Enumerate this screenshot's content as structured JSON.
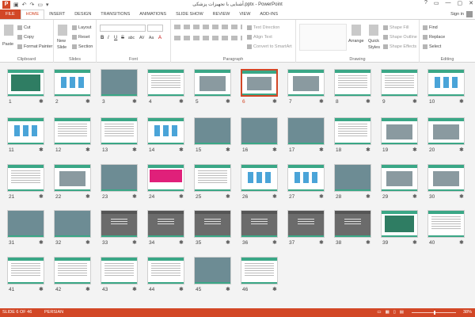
{
  "window": {
    "app_icon": "P",
    "title": "آشنایی با تجهیزات پزشکی.pptx - PowerPoint",
    "controls": [
      "?",
      "▭",
      "—",
      "▢",
      "✕"
    ]
  },
  "qat": {
    "save_icon": "▣",
    "undo_icon": "↶",
    "redo_icon": "↷",
    "start_icon": "▭",
    "more_icon": "▾"
  },
  "tabs": [
    "FILE",
    "HOME",
    "INSERT",
    "DESIGN",
    "TRANSITIONS",
    "ANIMATIONS",
    "SLIDE SHOW",
    "REVIEW",
    "VIEW",
    "ADD-INS"
  ],
  "active_tab": "HOME",
  "sign_in": "Sign in",
  "ribbon": {
    "clipboard": {
      "label": "Clipboard",
      "paste": "Paste",
      "cut": "Cut",
      "copy": "Copy",
      "format_painter": "Format Painter"
    },
    "slides": {
      "label": "Slides",
      "new_slide": "New",
      "new_slide_2": "Slide",
      "layout": "Layout",
      "reset": "Reset",
      "section": "Section"
    },
    "font": {
      "label": "Font",
      "bold": "B",
      "italic": "I",
      "underline": "U",
      "strike": "S",
      "shadow": "abc",
      "spacing": "AV",
      "case": "Aa",
      "color": "A"
    },
    "paragraph": {
      "label": "Paragraph",
      "text_direction": "Text Direction",
      "align_text": "Align Text",
      "convert_smartart": "Convert to SmartArt"
    },
    "drawing": {
      "label": "Drawing",
      "arrange": "Arrange",
      "quick_styles": "Quick",
      "quick_styles_2": "Styles",
      "shape_fill": "Shape Fill",
      "shape_outline": "Shape Outline",
      "shape_effects": "Shape Effects"
    },
    "editing": {
      "label": "Editing",
      "find": "Find",
      "replace": "Replace",
      "select": "Select"
    }
  },
  "slides": [
    {
      "n": "1",
      "style": "title"
    },
    {
      "n": "2",
      "style": "icons"
    },
    {
      "n": "3",
      "style": "photo"
    },
    {
      "n": "4",
      "style": "text"
    },
    {
      "n": "5",
      "style": "img"
    },
    {
      "n": "6",
      "style": "img"
    },
    {
      "n": "7",
      "style": "img"
    },
    {
      "n": "8",
      "style": "text"
    },
    {
      "n": "9",
      "style": "text"
    },
    {
      "n": "10",
      "style": "icons"
    },
    {
      "n": "11",
      "style": "icons"
    },
    {
      "n": "12",
      "style": "text"
    },
    {
      "n": "13",
      "style": "text"
    },
    {
      "n": "14",
      "style": "icons"
    },
    {
      "n": "15",
      "style": "photo"
    },
    {
      "n": "16",
      "style": "photo"
    },
    {
      "n": "17",
      "style": "photo"
    },
    {
      "n": "18",
      "style": "text"
    },
    {
      "n": "19",
      "style": "img"
    },
    {
      "n": "20",
      "style": "img"
    },
    {
      "n": "21",
      "style": "text"
    },
    {
      "n": "22",
      "style": "img"
    },
    {
      "n": "23",
      "style": "photo"
    },
    {
      "n": "24",
      "style": "pink"
    },
    {
      "n": "25",
      "style": "text"
    },
    {
      "n": "26",
      "style": "icons"
    },
    {
      "n": "27",
      "style": "icons"
    },
    {
      "n": "28",
      "style": "photo"
    },
    {
      "n": "29",
      "style": "img"
    },
    {
      "n": "30",
      "style": "img"
    },
    {
      "n": "31",
      "style": "photo"
    },
    {
      "n": "32",
      "style": "photo"
    },
    {
      "n": "33",
      "style": "dark"
    },
    {
      "n": "34",
      "style": "dark"
    },
    {
      "n": "35",
      "style": "dark"
    },
    {
      "n": "36",
      "style": "dark"
    },
    {
      "n": "37",
      "style": "dark"
    },
    {
      "n": "38",
      "style": "dark"
    },
    {
      "n": "39",
      "style": "title"
    },
    {
      "n": "40",
      "style": "text"
    },
    {
      "n": "41",
      "style": "text"
    },
    {
      "n": "42",
      "style": "text"
    },
    {
      "n": "43",
      "style": "text"
    },
    {
      "n": "44",
      "style": "text"
    },
    {
      "n": "45",
      "style": "photo"
    },
    {
      "n": "46",
      "style": "text"
    }
  ],
  "selected_slide": "6",
  "transition_marker": "✱",
  "status": {
    "slide_info": "SLIDE 6 OF 46",
    "language": "PERSIAN",
    "zoom": "38%",
    "view_icons": [
      "▭",
      "▦",
      "▯",
      "▤"
    ]
  },
  "colors": {
    "accent": "#d24726",
    "slide_theme": "#3aa786"
  }
}
